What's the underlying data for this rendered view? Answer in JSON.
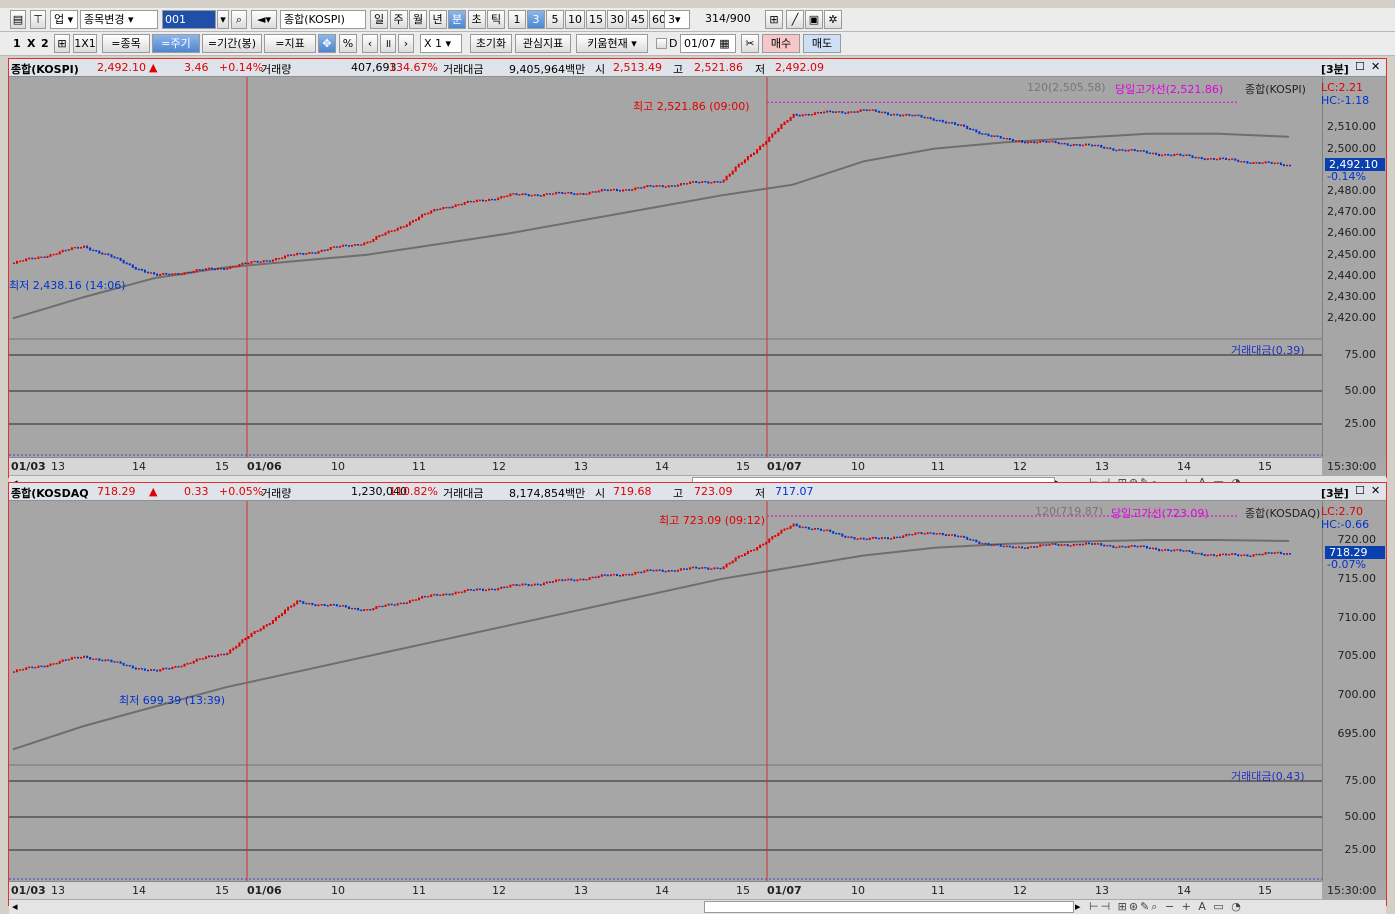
{
  "toolbar1": {
    "market": "업",
    "change_label": "종목변경",
    "code": "001",
    "name": "종합(KOSPI)",
    "periods": [
      "일",
      "주",
      "월",
      "년",
      "분",
      "초",
      "틱"
    ],
    "active_period": "분",
    "minutes": [
      "1",
      "3",
      "5",
      "10",
      "15",
      "30",
      "45",
      "60"
    ],
    "active_minute": "3",
    "count_select": "3",
    "count": "314",
    "count_max": "/900"
  },
  "toolbar2": {
    "layout": [
      "1",
      "X",
      "2"
    ],
    "layout_1x1": "1X1",
    "btn_stock": "=종목",
    "btn_period": "=주기",
    "btn_range": "=기간(봉)",
    "btn_indicator": "=지표",
    "percent": "%",
    "multiplier": "X 1",
    "reset": "초기화",
    "watch": "관심지표",
    "kiwoom": "키움현재",
    "date_check": "D",
    "date": "01/07",
    "buy": "매수",
    "sell": "매도"
  },
  "panels": [
    {
      "title": "종합(KOSPI)",
      "price": "2,492.10",
      "arrow": "▲",
      "change": "3.46",
      "pct": "+0.14%",
      "vol_label": "거래량",
      "vol": "407,693",
      "vol_pct": "134.67%",
      "amt_label": "거래대금",
      "amt": "9,405,964백만",
      "open_label": "시",
      "open": "2,513.49",
      "high_label": "고",
      "high": "2,521.86",
      "low_label": "저",
      "low": "2,492.09",
      "badge": "[3분]",
      "ma_label": "120(2,505.58)",
      "hiline_label": "당일고가선(2,521.86)",
      "series_label": "종합(KOSPI)",
      "lc": "LC:2.21",
      "hc": "HC:-1.18",
      "cur_price": "2,492.10",
      "cur_pct": "-0.14%",
      "max_label": "최고 2,521.86 (09:00)",
      "min_label": "최저 2,438.16 (14:06)",
      "yticks": [
        "2,510.00",
        "2,500.00",
        "2,480.00",
        "2,470.00",
        "2,460.00",
        "2,450.00",
        "2,440.00",
        "2,430.00",
        "2,420.00"
      ],
      "sub_label": "거래대금(0.39)",
      "sub_ticks": [
        "75.00",
        "50.00",
        "25.00"
      ],
      "xticks": [
        "01/03",
        "13",
        "14",
        "15",
        "01/06",
        "10",
        "11",
        "12",
        "13",
        "14",
        "15",
        "01/07",
        "10",
        "11",
        "12",
        "13",
        "14",
        "15"
      ],
      "xtime": "15:30:00"
    },
    {
      "title": "종합(KOSDAQ",
      "price": "718.29",
      "arrow": "▲",
      "change": "0.33",
      "pct": "+0.05%",
      "vol_label": "거래량",
      "vol": "1,230,040",
      "vol_pct": "110.82%",
      "amt_label": "거래대금",
      "amt": "8,174,854백만",
      "open_label": "시",
      "open": "719.68",
      "high_label": "고",
      "high": "723.09",
      "low_label": "저",
      "low": "717.07",
      "badge": "[3분]",
      "ma_label": "120(719.87)",
      "hiline_label": "당일고가선(723.09)",
      "series_label": "종합(KOSDAQ)",
      "lc": "LC:2.70",
      "hc": "HC:-0.66",
      "cur_price": "718.29",
      "cur_pct": "-0.07%",
      "max_label": "최고 723.09 (09:12)",
      "min_label": "최저 699.39 (13:39)",
      "yticks": [
        "720.00",
        "715.00",
        "710.00",
        "705.00",
        "700.00",
        "695.00"
      ],
      "sub_label": "거래대금(0.43)",
      "sub_ticks": [
        "75.00",
        "50.00",
        "25.00"
      ],
      "xticks": [
        "01/03",
        "13",
        "14",
        "15",
        "01/06",
        "10",
        "11",
        "12",
        "13",
        "14",
        "15",
        "01/07",
        "10",
        "11",
        "12",
        "13",
        "14",
        "15"
      ],
      "xtime": "15:30:00"
    }
  ],
  "colors": {
    "up": "#e00000",
    "down": "#0033cc",
    "ma": "#6e6e6e",
    "hiline": "#e000e0",
    "panel_border": "#dd3333",
    "vline": "#cc3333"
  },
  "chart_data": [
    {
      "type": "line",
      "title": "종합(KOSPI)",
      "ylim": [
        2414,
        2530
      ],
      "x": [
        "01/03 12:00",
        "01/03 13:00",
        "01/03 14:00",
        "01/03 15:00",
        "01/06 09:00",
        "01/06 10:00",
        "01/06 11:00",
        "01/06 12:00",
        "01/06 13:00",
        "01/06 14:00",
        "01/06 15:00",
        "01/07 09:00",
        "01/07 10:00",
        "01/07 11:00",
        "01/07 12:00",
        "01/07 13:00",
        "01/07 14:00",
        "01/07 15:00",
        "01/07 15:20"
      ],
      "series": [
        {
          "name": "종합(KOSPI)",
          "values": [
            2446,
            2454,
            2440,
            2444,
            2450,
            2456,
            2472,
            2478,
            2479,
            2482,
            2485,
            2516,
            2518,
            2514,
            2504,
            2502,
            2498,
            2495,
            2492.1
          ]
        },
        {
          "name": "120",
          "values": [
            2420,
            2430,
            2439,
            2444,
            2447,
            2450,
            2455,
            2460,
            2466,
            2472,
            2478,
            2483,
            2494,
            2500,
            2503,
            2505,
            2507,
            2507,
            2505.58
          ]
        }
      ]
    },
    {
      "type": "line",
      "title": "종합(KOSDAQ)",
      "ylim": [
        692,
        724
      ],
      "x": [
        "01/03 12:00",
        "01/03 13:00",
        "01/03 14:00",
        "01/03 15:00",
        "01/06 09:00",
        "01/06 10:00",
        "01/06 11:00",
        "01/06 12:00",
        "01/06 13:00",
        "01/06 14:00",
        "01/06 15:00",
        "01/07 09:00",
        "01/07 10:00",
        "01/07 11:00",
        "01/07 12:00",
        "01/07 13:00",
        "01/07 14:00",
        "01/07 15:00",
        "01/07 15:20"
      ],
      "series": [
        {
          "name": "종합(KOSDAQ)",
          "values": [
            703,
            705,
            703,
            705.5,
            712,
            711,
            713,
            714,
            715,
            716,
            716.5,
            722,
            720,
            721,
            719,
            719.5,
            719,
            718,
            718.29
          ]
        },
        {
          "name": "120",
          "values": [
            693,
            696,
            698.5,
            701,
            703,
            705,
            707,
            709,
            711,
            713,
            715,
            716.5,
            718,
            719,
            719.5,
            719.8,
            720,
            720,
            719.87
          ]
        }
      ]
    }
  ]
}
